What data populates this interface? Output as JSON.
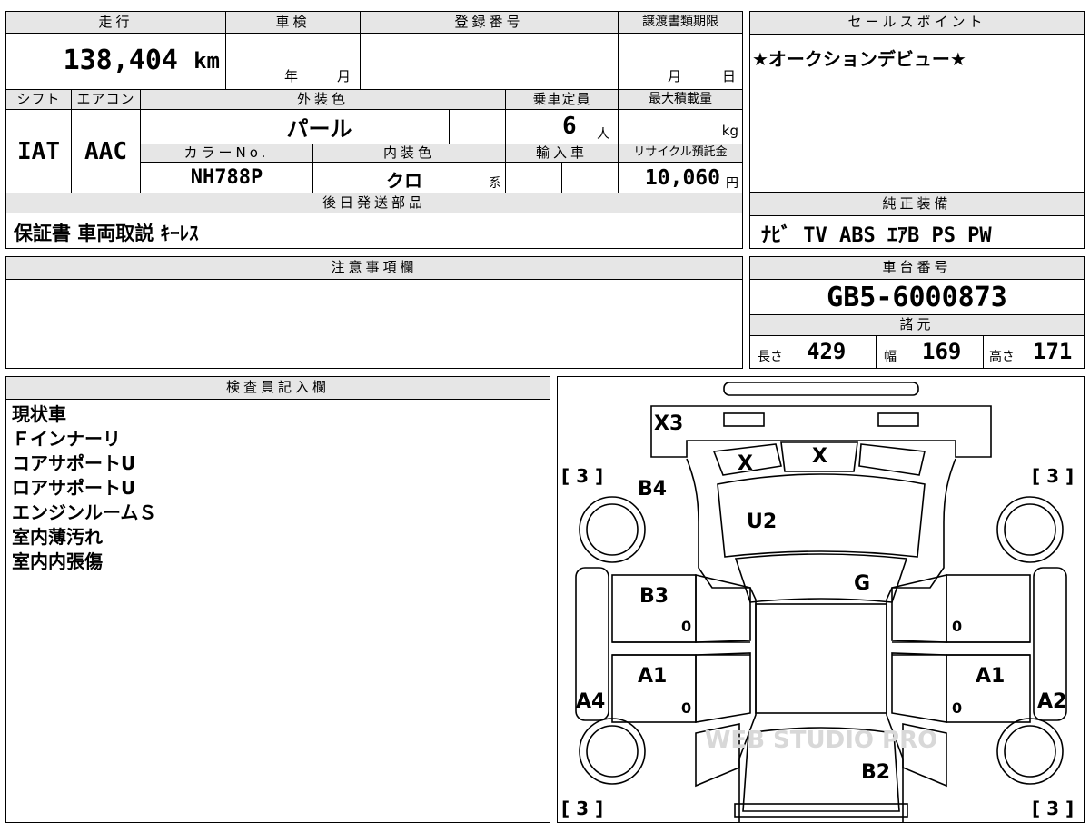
{
  "vehicle": {
    "mileage_label": "走行",
    "mileage_value": "138,404",
    "mileage_unit": "km",
    "shaken_label": "車検",
    "shaken_year": "年",
    "shaken_month": "月",
    "reg_no_label": "登録番号",
    "transfer_deadline_label": "譲渡書類期限",
    "transfer_month": "月",
    "transfer_day": "日",
    "shift_label": "シフト",
    "shift_value": "IAT",
    "aircon_label": "エアコン",
    "aircon_value": "AAC",
    "exterior_color_label": "外装色",
    "exterior_color_value": "パール",
    "capacity_label": "乗車定員",
    "capacity_value": "6",
    "capacity_unit": "人",
    "max_load_label": "最大積載量",
    "max_load_unit": "kg",
    "color_no_label": "カラーNo.",
    "color_no_value": "NH788P",
    "interior_color_label": "内装色",
    "interior_color_value": "クロ",
    "interior_suffix": "系",
    "import_label": "輸入車",
    "recycle_label": "リサイクル預託金",
    "recycle_value": "10,060",
    "recycle_unit": "円"
  },
  "later_parts": {
    "label": "後日発送部品",
    "value": "保証書 車両取説 ｷｰﾚｽ"
  },
  "sales_point": {
    "label": "セールスポイント",
    "value": "★オークションデビュー★"
  },
  "equipment": {
    "label": "純正装備",
    "value": "ﾅﾋﾞ TV ABS ｴｱB PS PW"
  },
  "caution": {
    "label": "注意事項欄"
  },
  "chassis": {
    "label": "車台番号",
    "value": "GB5-6000873"
  },
  "specs": {
    "label": "諸元",
    "length_label": "長さ",
    "length_value": "429",
    "width_label": "幅",
    "width_value": "169",
    "height_label": "高さ",
    "height_value": "171"
  },
  "inspector": {
    "label": "検査員記入欄",
    "notes": [
      "現状車",
      "Ｆインナーリ",
      "コアサポートU",
      "ロアサポートU",
      "エンジンルームＳ",
      "室内薄汚れ",
      "室内内張傷"
    ]
  },
  "diagram": {
    "marks": {
      "x3": "X3",
      "x_left": "X",
      "x_right": "X",
      "b4": "B4",
      "u2": "U2",
      "g": "G",
      "b3": "B3",
      "a1_left": "A1",
      "a1_right": "A1",
      "a4": "A4",
      "a2": "A2",
      "b2": "B2",
      "zero_1": "0",
      "zero_2": "0",
      "zero_3": "0",
      "zero_4": "0"
    },
    "tire_tl": "[ 3 ]",
    "tire_tr": "[ 3 ]",
    "tire_bl": "[ 3 ]",
    "tire_br": "[ 3 ]",
    "watermark": "WEB STUDIO PRO"
  }
}
